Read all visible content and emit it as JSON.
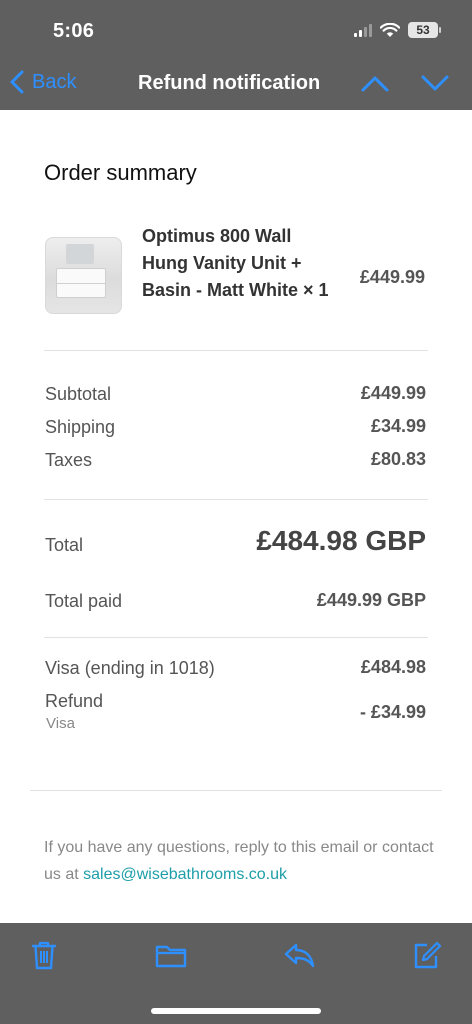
{
  "status": {
    "time": "5:06",
    "battery": "53"
  },
  "nav": {
    "back_label": "Back",
    "title": "Refund notification"
  },
  "order": {
    "section_title": "Order summary",
    "item": {
      "name": "Optimus 800 Wall Hung Vanity Unit + Basin - Matt White × 1",
      "price": "£449.99"
    },
    "subtotal_label": "Subtotal",
    "subtotal_value": "£449.99",
    "shipping_label": "Shipping",
    "shipping_value": "£34.99",
    "taxes_label": "Taxes",
    "taxes_value": "£80.83",
    "total_label": "Total",
    "total_value": "£484.98 GBP",
    "total_paid_label": "Total paid",
    "total_paid_value": "£449.99 GBP",
    "payment_label": "Visa (ending in 1018)",
    "payment_value": "£484.98",
    "refund_label": "Refund",
    "refund_method": "Visa",
    "refund_value": "- £34.99"
  },
  "footer": {
    "text": "If you have any questions, reply to this email or contact us at ",
    "email": "sales@wisebathrooms.co.uk"
  },
  "toolbar": {
    "icons": [
      "trash-icon",
      "folder-icon",
      "reply-icon",
      "compose-icon"
    ]
  },
  "colors": {
    "accent": "#2e8fff",
    "link": "#1d9ea8",
    "chrome": "#5f5f5f"
  }
}
